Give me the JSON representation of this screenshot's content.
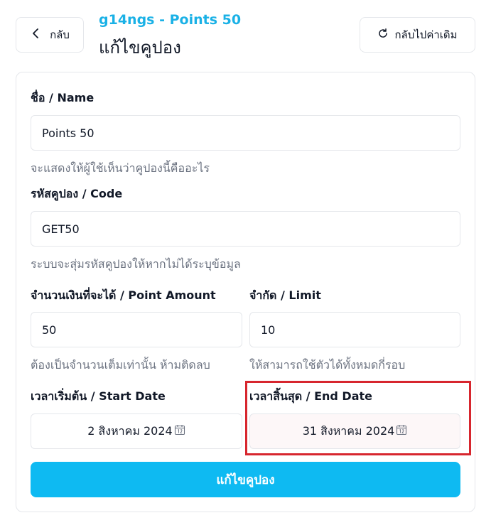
{
  "header": {
    "back_label": "กลับ",
    "subtitle": "g14ngs - Points 50",
    "title": "แก้ไขคูปอง",
    "reset_label": "กลับไปค่าเดิม"
  },
  "form": {
    "name": {
      "label": "ชื่อ / Name",
      "value": "Points 50",
      "hint": "จะแสดงให้ผู้ใช้เห็นว่าคูปองนี้คืออะไร"
    },
    "code": {
      "label": "รหัสคูปอง / Code",
      "value": "GET50",
      "hint": "ระบบจะสุ่มรหัสคูปองให้หากไม่ได้ระบุข้อมูล"
    },
    "point_amount": {
      "label": "จำนวนเงินที่จะได้ / Point Amount",
      "value": "50",
      "hint": "ต้องเป็นจำนวนเต็มเท่านั้น ห้ามติดลบ"
    },
    "limit": {
      "label": "จำกัด / Limit",
      "value": "10",
      "hint": "ให้สามารถใช้ตัวได้ทั้งหมดกี่รอบ"
    },
    "start_date": {
      "label": "เวลาเริ่มต้น / Start Date",
      "value": "2 สิงหาคม 2024"
    },
    "end_date": {
      "label": "เวลาสิ้นสุด / End Date",
      "value": "31 สิงหาคม 2024"
    },
    "submit_label": "แก้ไขคูปอง"
  },
  "icons": {
    "back": "chevron-left-icon",
    "reset": "refresh-icon",
    "calendar": "calendar-icon"
  },
  "colors": {
    "accent": "#0ebaf2",
    "subtitle": "#1ab1e6",
    "highlight": "#d7262e"
  }
}
